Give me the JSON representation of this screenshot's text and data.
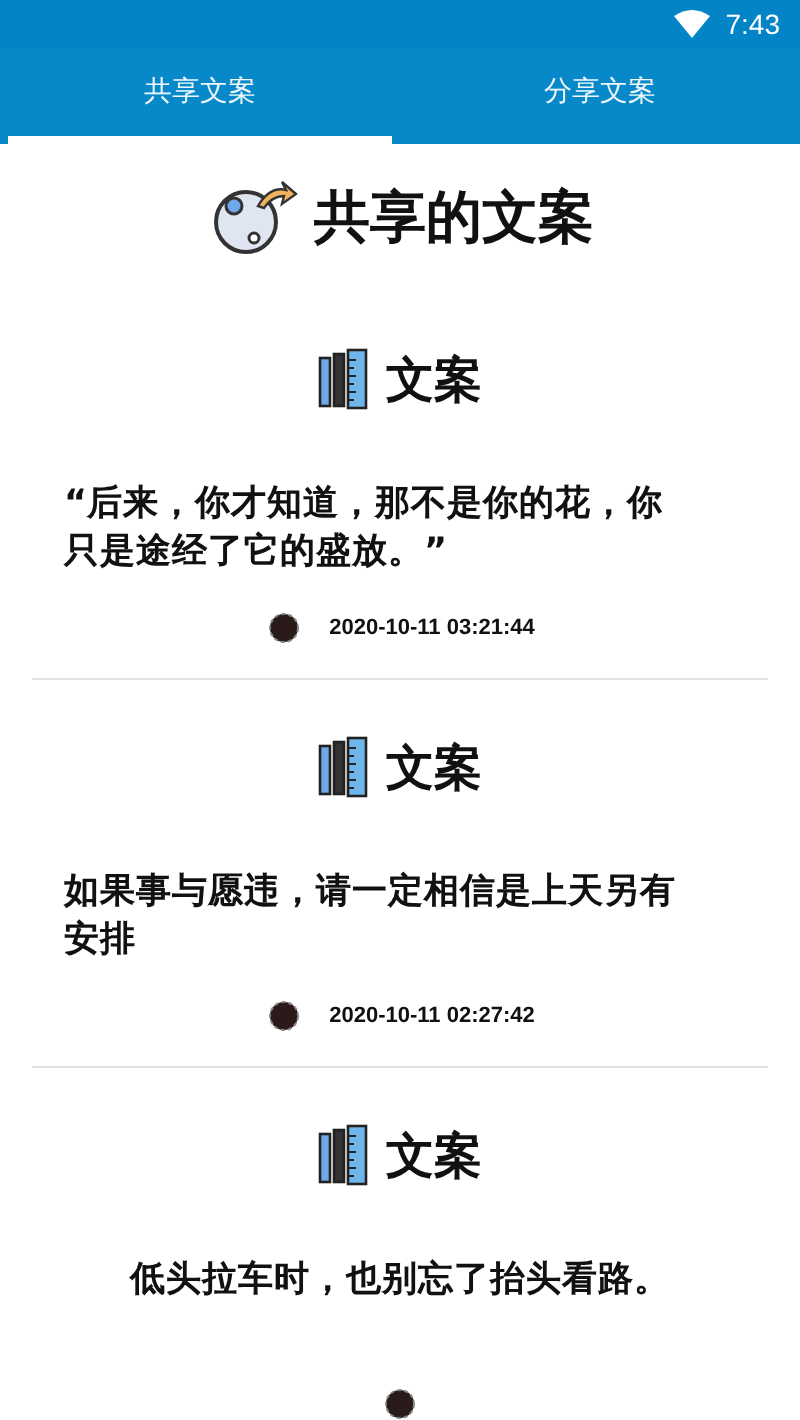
{
  "status_bar": {
    "time": "7:43"
  },
  "tabs": [
    {
      "label": "共享文案",
      "selected": true
    },
    {
      "label": "分享文案",
      "selected": false
    }
  ],
  "header": {
    "title": "共享的文案"
  },
  "posts": [
    {
      "heading": "文案",
      "text": "“后来，你才知道，那不是你的花，你只是途经了它的盛放。”",
      "centered": false,
      "time": "2020-10-11 03:21:44"
    },
    {
      "heading": "文案",
      "text": "如果事与愿违，请一定相信是上天另有安排",
      "centered": false,
      "time": "2020-10-11 02:27:42"
    },
    {
      "heading": "文案",
      "text": "低头拉车时，也别忘了抬头看路。",
      "centered": true
    }
  ]
}
